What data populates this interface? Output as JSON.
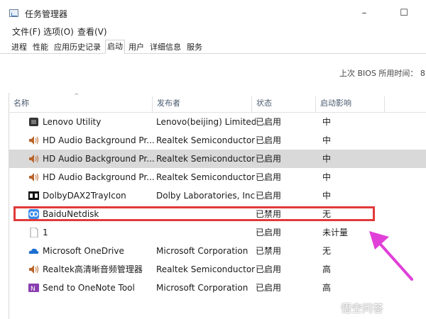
{
  "window": {
    "title": "任务管理器",
    "minimize": "–",
    "maximize": "☐"
  },
  "menu": [
    "文件(F)",
    "选项(O)",
    "查看(V)"
  ],
  "tabs": [
    "进程",
    "性能",
    "应用历史记录",
    "启动",
    "用户",
    "详细信息",
    "服务"
  ],
  "active_tab": "启动",
  "bios_label": "上次 BIOS 所用时间：  8",
  "columns": {
    "name": "名称",
    "publisher": "发布者",
    "status": "状态",
    "impact": "启动影响"
  },
  "rows": [
    {
      "icon": "lenovo-icon",
      "name": "Lenovo Utility",
      "publisher": "Lenovo(beijing) Limited",
      "status": "已启用",
      "impact": "中"
    },
    {
      "icon": "speaker-icon",
      "name": "HD Audio Background Pr...",
      "publisher": "Realtek Semiconductor",
      "status": "已启用",
      "impact": "中"
    },
    {
      "icon": "speaker-icon",
      "name": "HD Audio Background Pr...",
      "publisher": "Realtek Semiconductor",
      "status": "已启用",
      "impact": "中"
    },
    {
      "icon": "speaker-icon",
      "name": "HD Audio Background Pr...",
      "publisher": "Realtek Semiconductor",
      "status": "已启用",
      "impact": "中"
    },
    {
      "icon": "dolby-icon",
      "name": "DolbyDAX2TrayIcon",
      "publisher": "Dolby Laboratories, Inc.",
      "status": "已启用",
      "impact": "中"
    },
    {
      "icon": "baidu-netdisk-icon",
      "name": "BaiduNetdisk",
      "publisher": "",
      "status": "已禁用",
      "impact": "无"
    },
    {
      "icon": "file-icon",
      "name": "1",
      "publisher": "",
      "status": "已启用",
      "impact": "未计量"
    },
    {
      "icon": "onedrive-icon",
      "name": "Microsoft OneDrive",
      "publisher": "Microsoft Corporation",
      "status": "已禁用",
      "impact": "无"
    },
    {
      "icon": "speaker-icon",
      "name": "Realtek高清晰音频管理器",
      "publisher": "Realtek Semiconductor",
      "status": "已启用",
      "impact": "高"
    },
    {
      "icon": "onenote-icon",
      "name": "Send to OneNote Tool",
      "publisher": "Microsoft Corporation",
      "status": "已启用",
      "impact": "高"
    }
  ],
  "selected_row": 2,
  "highlighted_row": 5,
  "watermark": "悟空问答",
  "colors": {
    "highlight_box": "#e13a3a",
    "arrow": "#e040d8",
    "selected_row": "#d9d9d9"
  }
}
